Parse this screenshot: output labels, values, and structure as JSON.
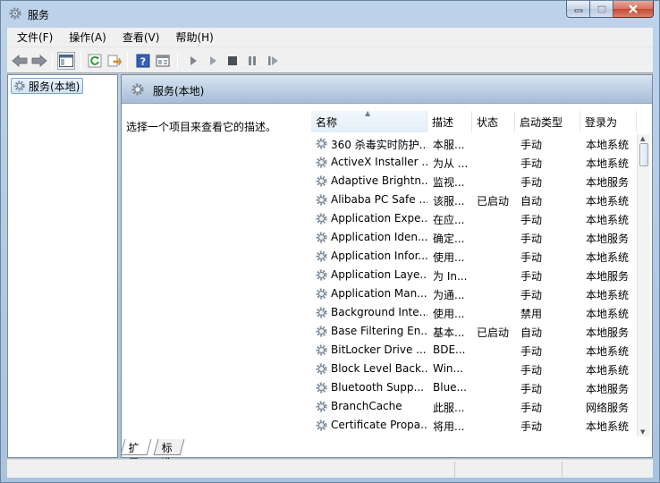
{
  "window": {
    "title": "服务",
    "colors": {
      "frame": "#b9d1ea",
      "accent": "#a6bdd6",
      "close": "#c4492f"
    }
  },
  "menu": [
    "文件(F)",
    "操作(A)",
    "查看(V)",
    "帮助(H)"
  ],
  "toolbar": {
    "icons": [
      "back-arrow-icon",
      "forward-arrow-icon",
      "show-hide-console-tree-icon",
      "refresh-icon",
      "export-list-icon",
      "help-icon",
      "properties-icon",
      "start-service-icon",
      "start-service-alt-icon",
      "stop-service-icon",
      "pause-service-icon",
      "restart-service-icon"
    ]
  },
  "tree": {
    "item": "服务(本地)"
  },
  "pane": {
    "title": "服务(本地)",
    "description": "选择一个项目来查看它的描述。"
  },
  "list": {
    "columns": [
      "名称",
      "描述",
      "状态",
      "启动类型",
      "登录为"
    ],
    "rows": [
      {
        "name": "360 杀毒实时防护...",
        "desc": "本服...",
        "state": "",
        "start": "手动",
        "logon": "本地系统"
      },
      {
        "name": "ActiveX Installer ...",
        "desc": "为从 ...",
        "state": "",
        "start": "手动",
        "logon": "本地系统"
      },
      {
        "name": "Adaptive Brightn...",
        "desc": "监视...",
        "state": "",
        "start": "手动",
        "logon": "本地服务"
      },
      {
        "name": "Alibaba PC Safe ...",
        "desc": "该服...",
        "state": "已启动",
        "start": "自动",
        "logon": "本地系统"
      },
      {
        "name": "Application Expe...",
        "desc": "在应...",
        "state": "",
        "start": "手动",
        "logon": "本地系统"
      },
      {
        "name": "Application Iden...",
        "desc": "确定...",
        "state": "",
        "start": "手动",
        "logon": "本地服务"
      },
      {
        "name": "Application Infor...",
        "desc": "使用...",
        "state": "",
        "start": "手动",
        "logon": "本地系统"
      },
      {
        "name": "Application Laye...",
        "desc": "为 In...",
        "state": "",
        "start": "手动",
        "logon": "本地服务"
      },
      {
        "name": "Application Man...",
        "desc": "为通...",
        "state": "",
        "start": "手动",
        "logon": "本地系统"
      },
      {
        "name": "Background Inte...",
        "desc": "使用...",
        "state": "",
        "start": "禁用",
        "logon": "本地系统"
      },
      {
        "name": "Base Filtering En...",
        "desc": "基本...",
        "state": "已启动",
        "start": "自动",
        "logon": "本地服务"
      },
      {
        "name": "BitLocker Drive ...",
        "desc": "BDE...",
        "state": "",
        "start": "手动",
        "logon": "本地系统"
      },
      {
        "name": "Block Level Back...",
        "desc": "Win...",
        "state": "",
        "start": "手动",
        "logon": "本地系统"
      },
      {
        "name": "Bluetooth Supp...",
        "desc": "Blue...",
        "state": "",
        "start": "手动",
        "logon": "本地服务"
      },
      {
        "name": "BranchCache",
        "desc": "此服...",
        "state": "",
        "start": "手动",
        "logon": "网络服务"
      },
      {
        "name": "Certificate Propa...",
        "desc": "将用...",
        "state": "",
        "start": "手动",
        "logon": "本地系统"
      }
    ]
  },
  "tabs": [
    "扩展",
    "标准"
  ]
}
